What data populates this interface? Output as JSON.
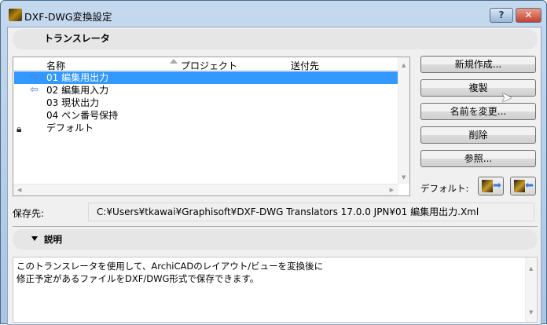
{
  "window": {
    "title": "DXF-DWG変換設定",
    "help_label": "?",
    "close_label": "✕"
  },
  "translators_header": "トランスレータ",
  "list": {
    "columns": [
      "名称",
      "プロジェクト",
      "送付先"
    ],
    "rows": [
      {
        "name": "01 編集用出力",
        "icon": "export-arrow-icon",
        "selected": true
      },
      {
        "name": "02 編集用入力",
        "icon": "import-arrow-icon",
        "selected": false
      },
      {
        "name": "03 現状出力",
        "icon": "",
        "selected": false
      },
      {
        "name": "04 ペン番号保持",
        "icon": "",
        "selected": false
      },
      {
        "name": "デフォルト",
        "icon": "lock-icon",
        "selected": false
      }
    ]
  },
  "buttons": {
    "new": "新規作成...",
    "duplicate": "複製",
    "rename": "名前を変更...",
    "delete": "削除",
    "browse": "参照..."
  },
  "default_label": "デフォルト:",
  "save_location": {
    "label": "保存先:",
    "value": "C:¥Users¥tkawai¥Graphisoft¥DXF-DWG Translators 17.0.0 JPN¥01 編集用出力.Xml"
  },
  "description": {
    "header": "説明",
    "lines": [
      "このトランスレータを使用して、ArchiCADのレイアウト/ビューを変換後に",
      "修正予定があるファイルをDXF/DWG形式で保存できます。"
    ]
  }
}
